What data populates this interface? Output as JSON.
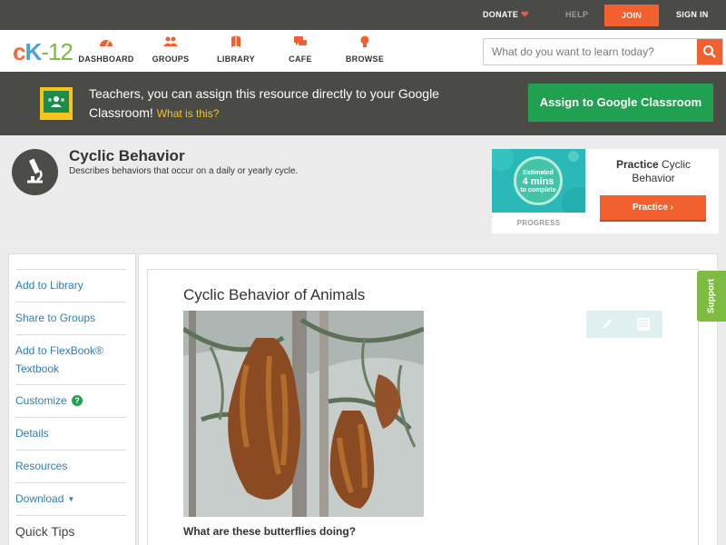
{
  "topbar": {
    "donate": "DONATE",
    "help": "HELP",
    "join": "JOIN",
    "signin": "SIGN IN"
  },
  "nav": {
    "logo": {
      "c": "c",
      "k": "K",
      "num": "-12"
    },
    "items": [
      {
        "label": "DASHBOARD",
        "icon": "dashboard-icon"
      },
      {
        "label": "GROUPS",
        "icon": "groups-icon"
      },
      {
        "label": "LIBRARY",
        "icon": "library-icon"
      },
      {
        "label": "CAFE",
        "icon": "cafe-icon"
      },
      {
        "label": "BROWSE",
        "icon": "browse-icon"
      }
    ],
    "search_placeholder": "What do you want to learn today?"
  },
  "banner": {
    "text": "Teachers, you can assign this resource directly to your Google Classroom!",
    "what_is_this": "What is this?",
    "button": "Assign to Google Classroom"
  },
  "concept": {
    "title": "Cyclic Behavior",
    "description": "Describes behaviors that occur on a daily or yearly cycle."
  },
  "practice": {
    "estimated": "Estimated",
    "mins": "4 mins",
    "to_complete": "to complete",
    "progress_label": "PROGRESS",
    "title_bold": "Practice",
    "title_rest": "Cyclic Behavior",
    "button": "Practice"
  },
  "sidebar": {
    "items": [
      {
        "label": "Add to Library"
      },
      {
        "label": "Share to Groups"
      },
      {
        "label": "Add to FlexBook® Textbook"
      },
      {
        "label": "Customize"
      },
      {
        "label": "Details"
      },
      {
        "label": "Resources"
      },
      {
        "label": "Download"
      },
      {
        "label": "Quick Tips"
      }
    ]
  },
  "lesson": {
    "title": "Cyclic Behavior of Animals",
    "question": "What are these butterflies doing?"
  },
  "support": "Support",
  "colors": {
    "accent": "#f26030",
    "dark": "#4a4a46",
    "google_green": "#20a150",
    "link": "#2f7db6",
    "support_green": "#7dbb42"
  }
}
